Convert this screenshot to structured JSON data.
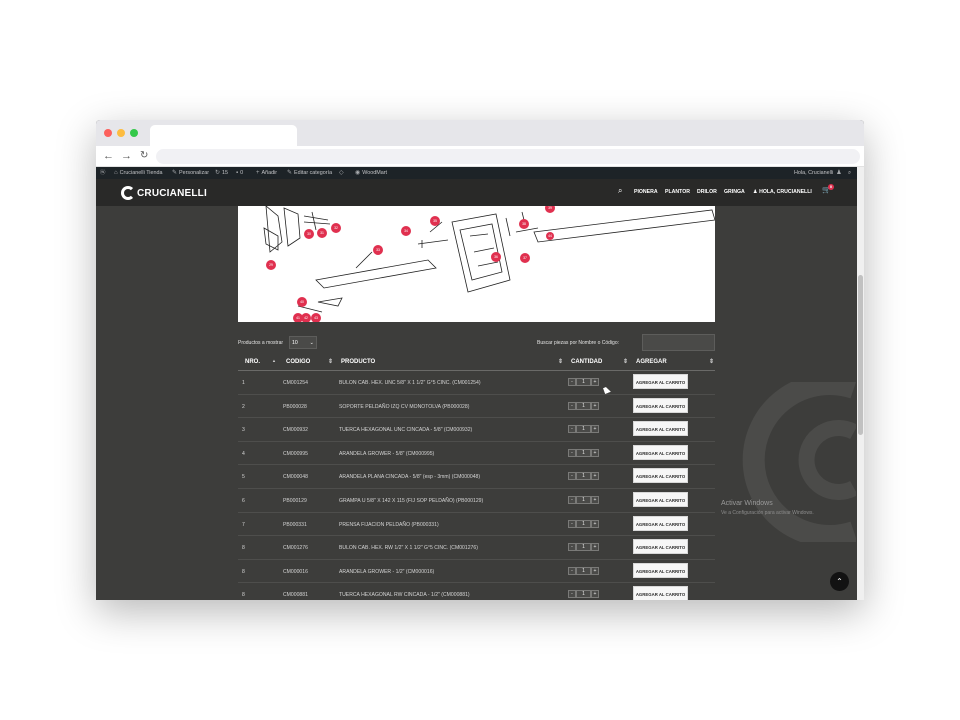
{
  "admin_bar": {
    "site_name": "Crucianelli Tienda",
    "customize": "Personalizar",
    "updates": "15",
    "comments": "0",
    "new": "Añadir",
    "edit_category": "Editar categoría",
    "woodmart": "WoodMart",
    "greeting": "Hola, Crucianelli"
  },
  "header": {
    "logo_text": "CRUCIANELLI",
    "nav": [
      "PIONERA",
      "PLANTOR",
      "DRILOR",
      "GRINGA"
    ],
    "account": "HOLA, CRUCIANELLI",
    "cart_count": "0"
  },
  "diagram_labels": [
    "29",
    "30",
    "31",
    "32",
    "33",
    "34",
    "35",
    "36",
    "37",
    "38",
    "39",
    "40",
    "41",
    "42",
    "43",
    "44"
  ],
  "controls": {
    "show_label": "Productos a mostrar",
    "show_value": "10",
    "search_label": "Buscar piezas por Nombre o Código:",
    "search_value": ""
  },
  "table": {
    "headers": [
      "NRO.",
      "CODIGO",
      "PRODUCTO",
      "CANTIDAD",
      "AGREGAR"
    ],
    "rows": [
      {
        "nro": "1",
        "code": "CM001254",
        "product": "BULON CAB. HEX. UNC 5/8\" X 1 1/2\" G°5 CINC. (CM001254)",
        "qty": "1",
        "btn": "AGREGAR AL CARRITO"
      },
      {
        "nro": "2",
        "code": "PB000028",
        "product": "SOPORTE PELDAÑO IZQ CV MONOTOLVA (PB000028)",
        "qty": "1",
        "btn": "AGREGAR AL CARRITO"
      },
      {
        "nro": "3",
        "code": "CM000932",
        "product": "TUERCA HEXAGONAL UNC CINCADA - 5/8\" (CM000932)",
        "qty": "1",
        "btn": "AGREGAR AL CARRITO"
      },
      {
        "nro": "4",
        "code": "CM000995",
        "product": "ARANDELA GROWER - 5/8\" (CM000995)",
        "qty": "1",
        "btn": "AGREGAR AL CARRITO"
      },
      {
        "nro": "5",
        "code": "CM000048",
        "product": "ARANDELA PLANA CINCADA - 5/8\" (esp - 3mm) (CM000048)",
        "qty": "1",
        "btn": "AGREGAR AL CARRITO"
      },
      {
        "nro": "6",
        "code": "PB000129",
        "product": "GRAMPA U 5/8\" X 142 X 115 (FIJ SOP PELDAÑO) (PB000129)",
        "qty": "1",
        "btn": "AGREGAR AL CARRITO"
      },
      {
        "nro": "7",
        "code": "PB000331",
        "product": "PRENSA FIJACION PELDAÑO (PB000331)",
        "qty": "1",
        "btn": "AGREGAR AL CARRITO"
      },
      {
        "nro": "8",
        "code": "CM001276",
        "product": "BULON CAB. HEX. RW 1/2\" X 1 1/2\" G°5 CINC. (CM001276)",
        "qty": "1",
        "btn": "AGREGAR AL CARRITO"
      },
      {
        "nro": "8",
        "code": "CM000016",
        "product": "ARANDELA GROWER - 1/2\" (CM000016)",
        "qty": "1",
        "btn": "AGREGAR AL CARRITO"
      },
      {
        "nro": "8",
        "code": "CM000881",
        "product": "TUERCA HEXAGONAL RW CINCADA - 1/2\" (CM000881)",
        "qty": "1",
        "btn": "AGREGAR AL CARRITO"
      }
    ]
  },
  "watermark": {
    "line1": "Activar Windows",
    "line2": "Ve a Configuración para activar Windows."
  },
  "colors": {
    "accent_red": "#e0304f",
    "header_bg": "#292928",
    "page_bg": "#3d3d3b"
  }
}
